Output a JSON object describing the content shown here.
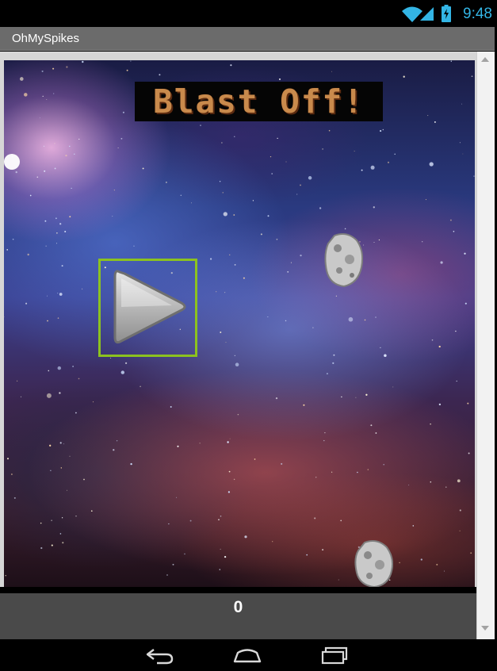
{
  "status_bar": {
    "time": "9:48",
    "icons": [
      "wifi-icon",
      "signal-icon",
      "battery-icon"
    ],
    "accent_color": "#33b5e5"
  },
  "app": {
    "title": "OhMySpikes"
  },
  "game": {
    "title_banner": "Blast Off!",
    "play_button_icon": "play-icon",
    "play_button_border_color": "#8cc21f",
    "score": "0",
    "sprites": [
      "asteroid",
      "asteroid"
    ]
  },
  "nav_bar": {
    "icons": [
      "back-icon",
      "home-icon",
      "recents-icon"
    ]
  }
}
